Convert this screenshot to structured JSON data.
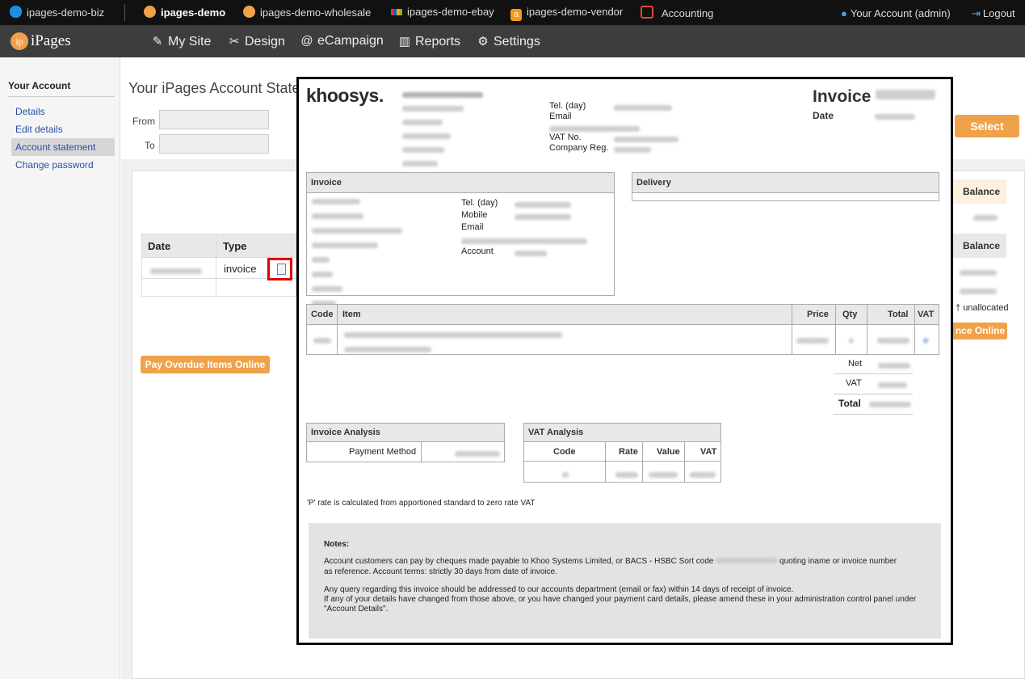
{
  "topbar": {
    "sites": [
      "ipages-demo-biz",
      "ipages-demo",
      "ipages-demo-wholesale",
      "ipages-demo-ebay",
      "ipages-demo-vendor",
      "Accounting"
    ],
    "account": "Your Account (admin)",
    "logout": "Logout"
  },
  "nav": {
    "logo_badge": "ip",
    "logo": "iPages",
    "items": [
      "My Site",
      "Design",
      "eCampaign",
      "Reports",
      "Settings"
    ]
  },
  "sidebar": {
    "title": "Your Account",
    "links": [
      "Details",
      "Edit details",
      "Account statement",
      "Change password"
    ],
    "active": "Account statement"
  },
  "main": {
    "title": "Your iPages Account State",
    "from_label": "From",
    "to_label": "To",
    "select_button": "Select",
    "balance_header_1": "Balance",
    "balance_header_2": "Balance",
    "table_headers": [
      "Date",
      "Type"
    ],
    "row_type": "invoice",
    "unallocated": "unallocated",
    "pay_online_partial": "nce Online",
    "pay_overdue": "Pay Overdue Items Online"
  },
  "invoice": {
    "logo": "khoosys.",
    "heading": "Invoice",
    "date_label": "Date",
    "company_fields": [
      "Tel. (day)",
      "Email",
      "",
      "VAT No.",
      "Company Reg."
    ],
    "invoice_box_title": "Invoice",
    "delivery_box_title": "Delivery",
    "customer_fields": [
      "Tel. (day)",
      "Mobile",
      "Email",
      "",
      "Account"
    ],
    "items_headers": [
      "Code",
      "Item",
      "Price",
      "Qty",
      "Total",
      "VAT"
    ],
    "totals": [
      "Net",
      "VAT",
      "Total"
    ],
    "analysis_title": "Invoice Analysis",
    "payment_method_label": "Payment Method",
    "vat_analysis_title": "VAT Analysis",
    "vat_headers": [
      "Code",
      "Rate",
      "Value",
      "VAT"
    ],
    "p_rate_note": "'P' rate is calculated from apportioned standard to zero rate VAT",
    "notes_title": "Notes:",
    "notes_1a": "Account customers can pay by cheques made payable to Khoo Systems Limited, or BACS - HSBC Sort code",
    "notes_1b": "quoting iname or invoice number",
    "notes_1c": "as reference. Account terms: strictly 30 days from date of invoice.",
    "notes_2": "Any query regarding this invoice should be addressed to our accounts department (email or fax) within 14 days of receipt of invoice.",
    "notes_3a": "If any of your details have changed from those above, or you have changed your payment card details, please amend these in your administration control panel under",
    "notes_3b": "\"Account Details\"."
  },
  "colors": {
    "accent": "#f0a24a",
    "link": "#2a4fa8",
    "highlight": "#e00000"
  }
}
